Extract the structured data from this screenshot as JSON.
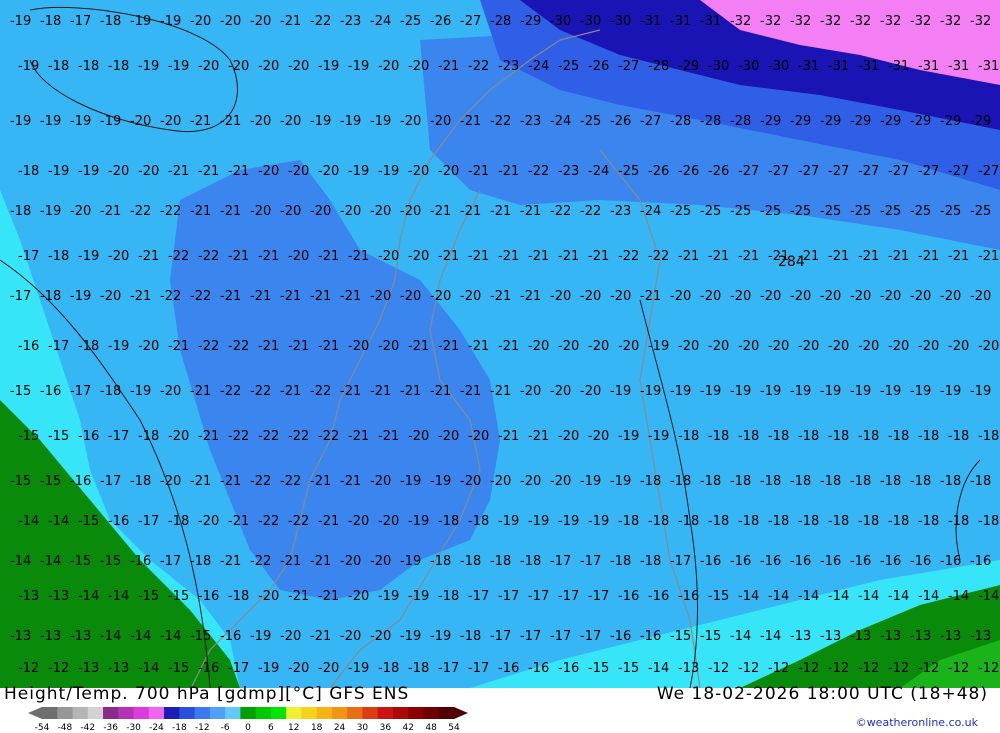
{
  "title_left": "Height/Temp. 700 hPa [gdmp][°C] GFS ENS",
  "title_right": "We 18-02-2026 18:00 UTC (18+48)",
  "credit": "©weatheronline.co.uk",
  "legend": {
    "ticks": [
      "-54",
      "-48",
      "-42",
      "-36",
      "-30",
      "-24",
      "-18",
      "-12",
      "-6",
      "0",
      "6",
      "12",
      "18",
      "24",
      "30",
      "36",
      "42",
      "48",
      "54"
    ],
    "colors": [
      "#6e6e6e",
      "#969696",
      "#b4b4b4",
      "#d2d2d2",
      "#8c2a8c",
      "#b432b4",
      "#dc3cdc",
      "#f064f0",
      "#1e1eb4",
      "#2850dc",
      "#3c78f0",
      "#50a0f5",
      "#64c8fa",
      "#00a000",
      "#00c800",
      "#00e600",
      "#f0f032",
      "#f5d21e",
      "#f5b414",
      "#f09614",
      "#e66e14",
      "#dc3c14",
      "#c81414",
      "#aa0a0a",
      "#8c0000",
      "#6e0000",
      "#500000"
    ]
  },
  "zone_colors": {
    "magenta": "#f47ef4",
    "dark_navy": "#1a14b4",
    "mid_blue": "#2e5fe6",
    "blue": "#3a86ee",
    "light_blue": "#36b6f4",
    "cyan": "#36e6f8",
    "green": "#0a8a0a",
    "bright_green": "#1ab41a"
  },
  "isotherm_labels": [
    {
      "v": "-32"
    },
    {
      "v": "-31"
    },
    {
      "v": "-30"
    },
    {
      "v": "-29"
    },
    {
      "v": "-28"
    },
    {
      "v": "-27"
    },
    {
      "v": "-26"
    },
    {
      "v": "-25"
    },
    {
      "v": "-24"
    },
    {
      "v": "-23"
    },
    {
      "v": "-22"
    },
    {
      "v": "-21"
    },
    {
      "v": "-20"
    },
    {
      "v": "-19"
    },
    {
      "v": "-18"
    },
    {
      "v": "-17"
    },
    {
      "v": "-16"
    },
    {
      "v": "-15"
    },
    {
      "v": "-14"
    },
    {
      "v": "-13"
    },
    {
      "v": "-12"
    }
  ],
  "height_label": "284"
}
